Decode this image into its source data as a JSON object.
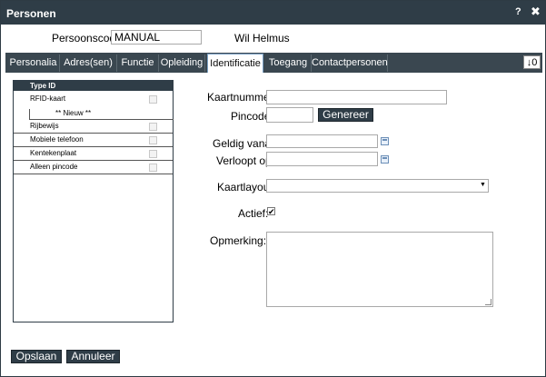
{
  "window": {
    "title": "Personen",
    "help_label": "?",
    "close_label": "✖"
  },
  "header": {
    "persoonscode_label": "Persoonscode:",
    "persoonscode_value": "MANUAL",
    "name": "Wil Helmus"
  },
  "tabs": [
    {
      "label": "Personalia"
    },
    {
      "label": "Adres(sen)"
    },
    {
      "label": "Functie"
    },
    {
      "label": "Opleiding"
    },
    {
      "label": "Identificatie"
    },
    {
      "label": "Toegang"
    },
    {
      "label": "Contactpersonen"
    }
  ],
  "tab_count": "↓0",
  "typelist": {
    "header": "Type ID",
    "rows": [
      "RFID-kaart",
      "Rijbewijs",
      "Mobiele telefoon",
      "Kentekenplaat",
      "Alleen pincode"
    ],
    "new_label": "** Nieuw **"
  },
  "form": {
    "kaartnummer_label": "Kaartnummer:",
    "kaartnummer_value": "",
    "pincode_label": "Pincode:",
    "pincode_value": "",
    "genereer_label": "Genereer",
    "geldig_label": "Geldig vanaf:",
    "geldig_value": "",
    "verloopt_label": "Verloopt op:",
    "verloopt_value": "",
    "kaartlayout_label": "Kaartlayout:",
    "kaartlayout_value": "",
    "actief_label": "Actief:",
    "actief_checked": true,
    "actief_mark": "✔",
    "opmerking_label": "Opmerking:",
    "opmerking_value": ""
  },
  "footer": {
    "save_label": "Opslaan",
    "cancel_label": "Annuleer"
  },
  "icons": {
    "dropdown": "▼",
    "calendar": "calendar-icon"
  }
}
